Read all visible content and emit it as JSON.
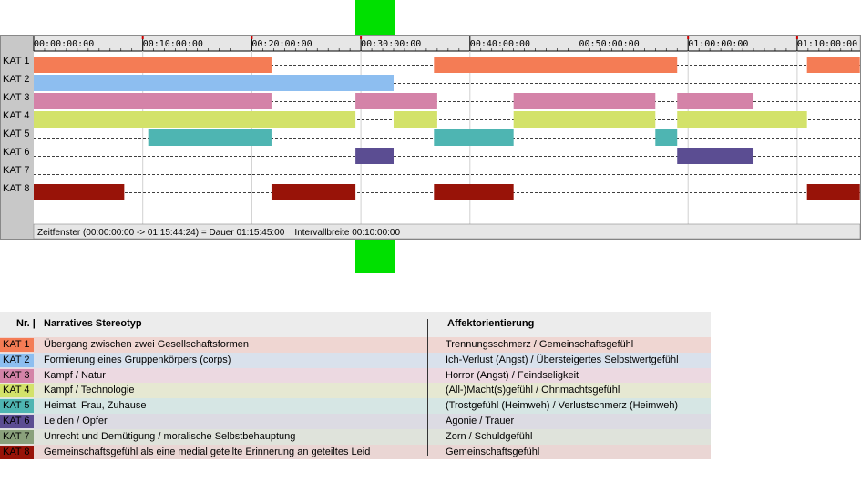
{
  "timeline": {
    "tick_labels": [
      "00:00:00:00",
      "00:10:00:00",
      "00:20:00:00",
      "00:30:00:00",
      "00:40:00:00",
      "00:50:00:00",
      "01:00:00:00",
      "01:10:00:00"
    ],
    "status": "Zeitfenster (00:00:00:00 -> 01:15:44:24) = Dauer 01:15:45:00    Intervallbreite 00:10:00:00"
  },
  "chart_data": {
    "type": "timeline",
    "x_unit": "minutes",
    "xlim": [
      0,
      75.75
    ],
    "tick_interval_minutes": 10,
    "categories": [
      "KAT 1",
      "KAT 2",
      "KAT 3",
      "KAT 4",
      "KAT 5",
      "KAT 6",
      "KAT 7",
      "KAT 8"
    ],
    "colors": [
      "#f47c55",
      "#8dbef0",
      "#d483a8",
      "#d3e26a",
      "#4eb5b2",
      "#5b4d92",
      "#8aa17c",
      "#981308"
    ],
    "segments": [
      [
        [
          0,
          21.8
        ],
        [
          36.7,
          59
        ],
        [
          70.9,
          75.75
        ]
      ],
      [
        [
          0,
          33
        ]
      ],
      [
        [
          0,
          21.8
        ],
        [
          29.5,
          37
        ],
        [
          44,
          57
        ],
        [
          59,
          66
        ]
      ],
      [
        [
          0,
          29.5
        ],
        [
          33,
          37
        ],
        [
          44,
          57
        ],
        [
          59,
          70.9
        ]
      ],
      [
        [
          10.5,
          21.8
        ],
        [
          36.7,
          44
        ],
        [
          57,
          59
        ]
      ],
      [
        [
          29.5,
          33
        ],
        [
          59,
          66
        ]
      ],
      [],
      [
        [
          0,
          8.3
        ],
        [
          21.8,
          29.5
        ],
        [
          36.7,
          44
        ],
        [
          70.9,
          75.75
        ]
      ]
    ]
  },
  "legend": {
    "header": {
      "nr": "Nr. |",
      "story": "Narratives Stereotyp",
      "affect": "Affektorientierung"
    },
    "rows": [
      {
        "nr": "KAT 1",
        "story": "Übergang zwischen zwei Gesellschaftsformen",
        "affect": "Trennungsschmerz / Gemeinschaftsgefühl",
        "color": "#f47c55",
        "bg": "#efd6d2"
      },
      {
        "nr": "KAT 2",
        "story": "Formierung eines Gruppenkörpers (corps)",
        "affect": "Ich-Verlust (Angst) / Übersteigertes Selbstwertgefühl",
        "color": "#8dbef0",
        "bg": "#d9e1ec"
      },
      {
        "nr": "KAT 3",
        "story": "Kampf / Natur",
        "affect": "Horror (Angst) / Feindseligkeit",
        "color": "#d483a8",
        "bg": "#ecd9e1"
      },
      {
        "nr": "KAT 4",
        "story": "Kampf / Technologie",
        "affect": "(All-)Macht(s)gefühl / Ohnmachtsgefühl",
        "color": "#d3e26a",
        "bg": "#e6e8d2"
      },
      {
        "nr": "KAT 5",
        "story": "Heimat, Frau, Zuhause",
        "affect": "(Trostgefühl (Heimweh) / Verlustschmerz (Heimweh)",
        "color": "#4eb5b2",
        "bg": "#d6e6e4"
      },
      {
        "nr": "KAT 6",
        "story": "Leiden / Opfer",
        "affect": "Agonie / Trauer",
        "color": "#5b4d92",
        "bg": "#dcdbe3"
      },
      {
        "nr": "KAT 7",
        "story": "Unrecht und Demütigung / moralische Selbstbehauptung",
        "affect": "Zorn / Schuldgefühl",
        "color": "#8aa17c",
        "bg": "#dfe3db"
      },
      {
        "nr": "KAT 8",
        "story": "Gemeinschaftsgefühl als eine medial geteilte Erinnerung an geteiltes Leid",
        "affect": "Gemeinschaftsgefühl",
        "color": "#981308",
        "bg": "#ead6d4"
      }
    ]
  }
}
